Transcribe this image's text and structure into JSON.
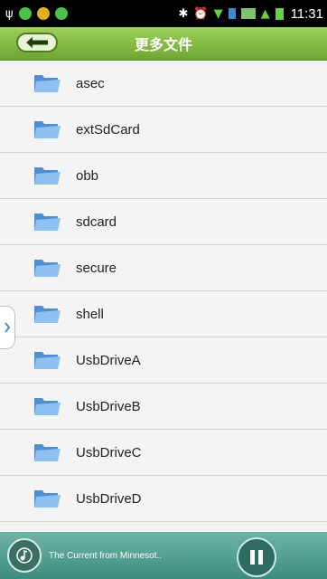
{
  "status": {
    "time": "11:31"
  },
  "header": {
    "title": "更多文件"
  },
  "list": {
    "items": [
      {
        "label": "asec"
      },
      {
        "label": "extSdCard"
      },
      {
        "label": "obb"
      },
      {
        "label": "sdcard"
      },
      {
        "label": "secure"
      },
      {
        "label": "shell"
      },
      {
        "label": "UsbDriveA"
      },
      {
        "label": "UsbDriveB"
      },
      {
        "label": "UsbDriveC"
      },
      {
        "label": "UsbDriveD"
      }
    ]
  },
  "player": {
    "track": "The Current from Minnesot.."
  },
  "colors": {
    "accent": "#7fbf45",
    "player": "#4f9e8e"
  }
}
